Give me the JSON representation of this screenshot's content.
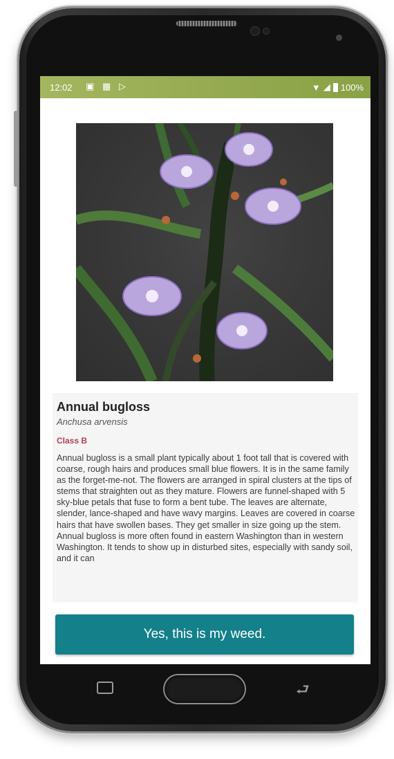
{
  "status_bar": {
    "time": "12:02",
    "notification_icons": [
      "image-icon",
      "calendar-icon",
      "play-store-icon"
    ],
    "right_icons": [
      "wifi-icon",
      "signal-icon",
      "battery-icon"
    ],
    "battery_text": "100%",
    "bar_color": "#97ad53"
  },
  "plant": {
    "photo_icon": "flower-photo",
    "common_name": "Annual bugloss",
    "scientific_name": "Anchusa arvensis",
    "class_label": "Class B",
    "description": "Annual bugloss is a small plant typically about 1 foot tall that is covered with coarse, rough hairs and produces small blue flowers. It is in the same family as the forget-me-not. The flowers are arranged in spiral clusters at the tips of stems that straighten out as they mature. Flowers are funnel-shaped with 5 sky-blue petals that fuse to form a bent tube. The leaves are alternate, slender, lance-shaped and have wavy margins. Leaves are covered in coarse hairs that have swollen bases. They get smaller in size going up the stem. Annual bugloss is more often found in eastern Washington than in western Washington. It tends to show up in disturbed sites, especially with sandy soil, and it can"
  },
  "actions": {
    "confirm_label": "Yes, this is my weed.",
    "confirm_color": "#13808a"
  },
  "colors": {
    "class_label": "#b43e58",
    "card_background": "#f5f5f5"
  },
  "device_nav": {
    "icons": [
      "recent-apps-icon",
      "home-button",
      "back-icon"
    ]
  }
}
